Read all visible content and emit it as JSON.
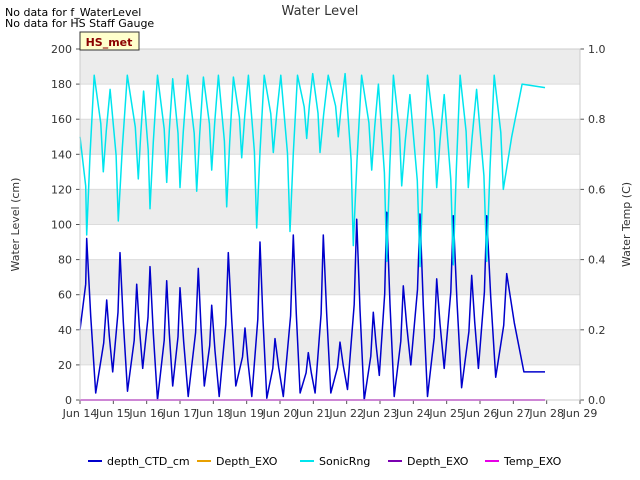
{
  "notes": [
    "No data for f_WaterLevel",
    "No data for HS Staff Gauge"
  ],
  "badge": "HS_met",
  "chart_data": {
    "type": "line",
    "title": "Water Level",
    "xlabel": "",
    "ylabel": "Water Level (cm)",
    "y2label": "Water Temp (C)",
    "xlim": [
      14,
      29
    ],
    "ylim": [
      0,
      200
    ],
    "y2lim": [
      0,
      1.0
    ],
    "x_ticks": [
      "Jun 14",
      "Jun 15",
      "Jun 16",
      "Jun 17",
      "Jun 18",
      "Jun 19",
      "Jun 20",
      "Jun 21",
      "Jun 22",
      "Jun 23",
      "Jun 24",
      "Jun 25",
      "Jun 26",
      "Jun 27",
      "Jun 28",
      "Jun 29"
    ],
    "y_ticks": [
      0,
      20,
      40,
      60,
      80,
      100,
      120,
      140,
      160,
      180,
      200
    ],
    "y2_ticks": [
      "0.0",
      "0.2",
      "0.4",
      "0.6",
      "0.8",
      "1.0"
    ],
    "grid": "horizontal bands",
    "legend_position": "bottom",
    "series": [
      {
        "name": "depth_CTD_cm",
        "color": "#0000cc",
        "axis": "left",
        "peaks": [
          [
            14.2,
            40,
            92,
            4
          ],
          [
            14.8,
            8,
            57,
            16
          ],
          [
            15.2,
            16,
            84,
            5
          ],
          [
            15.7,
            2,
            66,
            18
          ],
          [
            16.1,
            18,
            76,
            0
          ],
          [
            16.6,
            0,
            68,
            8
          ],
          [
            17.0,
            8,
            64,
            2
          ],
          [
            17.55,
            2,
            75,
            8
          ],
          [
            17.95,
            8,
            54,
            2
          ],
          [
            18.45,
            2,
            84,
            8
          ],
          [
            18.95,
            8,
            41,
            2
          ],
          [
            19.4,
            2,
            90,
            1
          ],
          [
            19.85,
            1,
            35,
            2
          ],
          [
            20.4,
            2,
            94,
            4
          ],
          [
            20.85,
            4,
            27,
            4
          ],
          [
            21.3,
            4,
            94,
            4
          ],
          [
            21.8,
            4,
            33,
            6
          ],
          [
            22.3,
            6,
            103,
            0
          ],
          [
            22.8,
            0,
            50,
            14
          ],
          [
            23.2,
            14,
            107,
            2
          ],
          [
            23.7,
            2,
            65,
            20
          ],
          [
            24.2,
            20,
            106,
            2
          ],
          [
            24.7,
            2,
            69,
            18
          ],
          [
            25.2,
            18,
            105,
            7
          ],
          [
            25.75,
            7,
            71,
            18
          ],
          [
            26.2,
            18,
            105,
            13
          ],
          [
            26.8,
            13,
            72,
            16
          ]
        ],
        "end": 27.95
      },
      {
        "name": "Depth_EXO",
        "color": "#e8a000",
        "axis": "left",
        "values": []
      },
      {
        "name": "SonicRng",
        "color": "#00e5ee",
        "axis": "left",
        "troughs": [
          [
            14.2,
            150,
            94,
            185
          ],
          [
            14.7,
            185,
            130,
            177
          ],
          [
            15.15,
            177,
            102,
            185
          ],
          [
            15.75,
            185,
            126,
            176
          ],
          [
            16.1,
            176,
            109,
            185
          ],
          [
            16.6,
            185,
            124,
            183
          ],
          [
            17.0,
            183,
            121,
            185
          ],
          [
            17.5,
            185,
            119,
            184
          ],
          [
            17.95,
            184,
            131,
            185
          ],
          [
            18.4,
            185,
            110,
            184
          ],
          [
            18.85,
            184,
            138,
            185
          ],
          [
            19.3,
            185,
            98,
            185
          ],
          [
            19.8,
            185,
            141,
            185
          ],
          [
            20.3,
            185,
            96,
            185
          ],
          [
            20.8,
            185,
            149,
            186
          ],
          [
            21.2,
            186,
            141,
            185
          ],
          [
            21.75,
            185,
            150,
            186
          ],
          [
            22.2,
            186,
            88,
            185
          ],
          [
            22.75,
            185,
            131,
            180
          ],
          [
            23.2,
            180,
            79,
            185
          ],
          [
            23.65,
            185,
            122,
            174
          ],
          [
            24.2,
            174,
            76,
            185
          ],
          [
            24.7,
            185,
            121,
            174
          ],
          [
            25.2,
            174,
            77,
            185
          ],
          [
            25.65,
            185,
            121,
            177
          ],
          [
            26.2,
            177,
            79,
            185
          ],
          [
            26.7,
            185,
            120,
            180
          ]
        ],
        "end": 27.95,
        "end_value": 178
      },
      {
        "name": "Depth_EXO",
        "color": "#7a00b0",
        "axis": "left",
        "values": [
          [
            14,
            0
          ],
          [
            27.95,
            0
          ]
        ]
      },
      {
        "name": "Temp_EXO",
        "color": "#e600e6",
        "axis": "right",
        "values": [
          [
            14,
            0
          ],
          [
            27.95,
            0
          ]
        ]
      }
    ]
  }
}
